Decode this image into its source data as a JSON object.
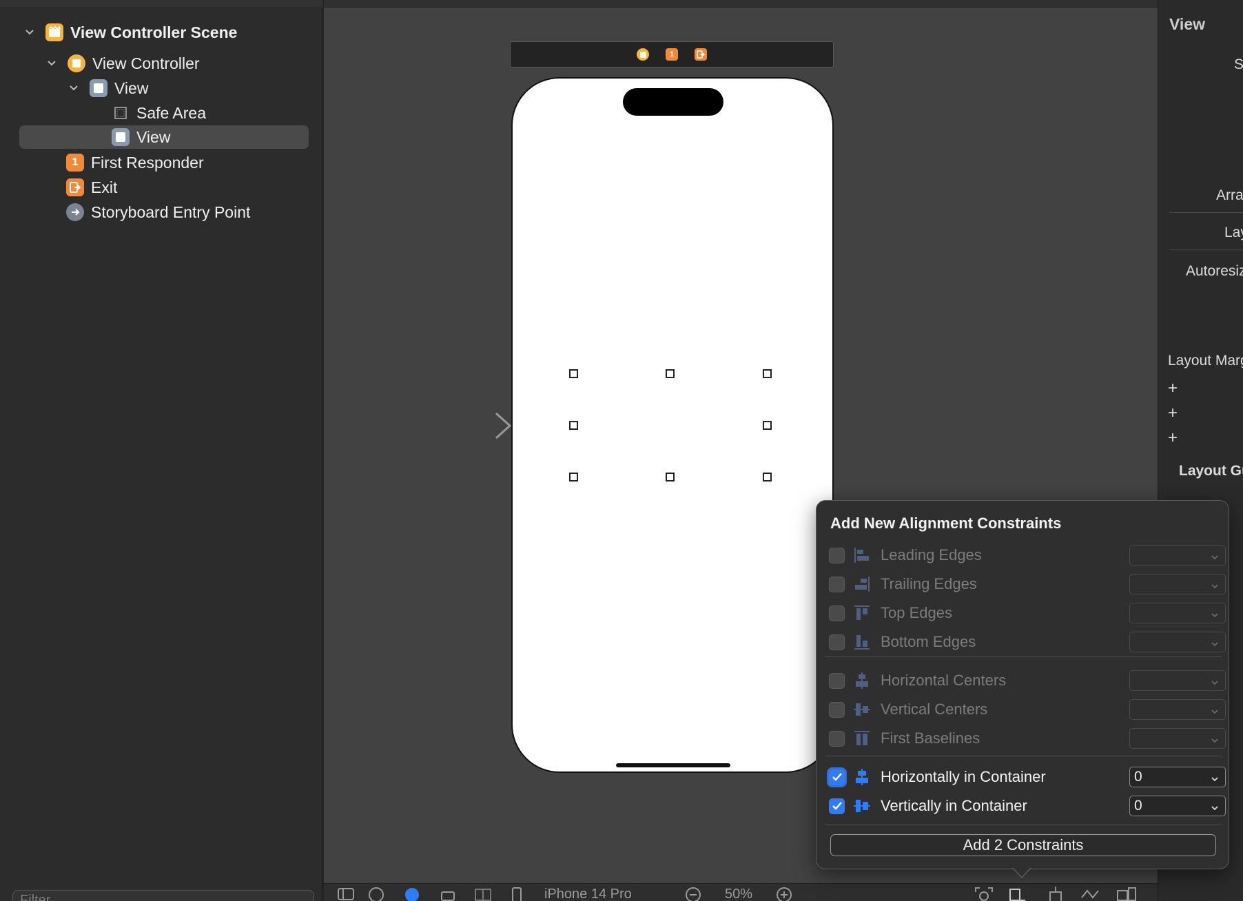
{
  "navigator": {
    "items": [
      {
        "label": "View Controller Scene",
        "icon": "scene-icon"
      },
      {
        "label": "View Controller",
        "icon": "view-controller-icon"
      },
      {
        "label": "View",
        "icon": "view-icon"
      },
      {
        "label": "Safe Area",
        "icon": "safe-area-icon"
      },
      {
        "label": "View",
        "icon": "view-icon",
        "selected": true
      },
      {
        "label": "First Responder",
        "icon": "first-responder-icon",
        "badge": "1"
      },
      {
        "label": "Exit",
        "icon": "exit-icon"
      },
      {
        "label": "Storyboard Entry Point",
        "icon": "entry-point-icon"
      }
    ],
    "filter_placeholder": "Filter"
  },
  "canvas": {
    "dock_badge": "1",
    "bottom": {
      "device_label": "iPhone 14 Pro",
      "zoom_label": "50%"
    }
  },
  "inspector": {
    "header": "View",
    "partial_labels": [
      "S",
      "Arra",
      "Lay",
      "Autoresiz",
      "Layout Marg",
      "+",
      "+",
      "+",
      "Layout Gu"
    ]
  },
  "popover": {
    "title": "Add New Alignment Constraints",
    "rows": [
      {
        "label": "Leading Edges",
        "checked": false,
        "value": ""
      },
      {
        "label": "Trailing Edges",
        "checked": false,
        "value": ""
      },
      {
        "label": "Top Edges",
        "checked": false,
        "value": ""
      },
      {
        "label": "Bottom Edges",
        "checked": false,
        "value": ""
      },
      {
        "label": "Horizontal Centers",
        "checked": false,
        "value": ""
      },
      {
        "label": "Vertical Centers",
        "checked": false,
        "value": ""
      },
      {
        "label": "First Baselines",
        "checked": false,
        "value": ""
      },
      {
        "label": "Horizontally in Container",
        "checked": true,
        "value": "0"
      },
      {
        "label": "Vertically in Container",
        "checked": true,
        "value": "0"
      }
    ],
    "add_button_label": "Add 2 Constraints"
  },
  "colors": {
    "accent": "#2f7df6",
    "orange": "#f08a3b",
    "yellow": "#f5b53f"
  }
}
